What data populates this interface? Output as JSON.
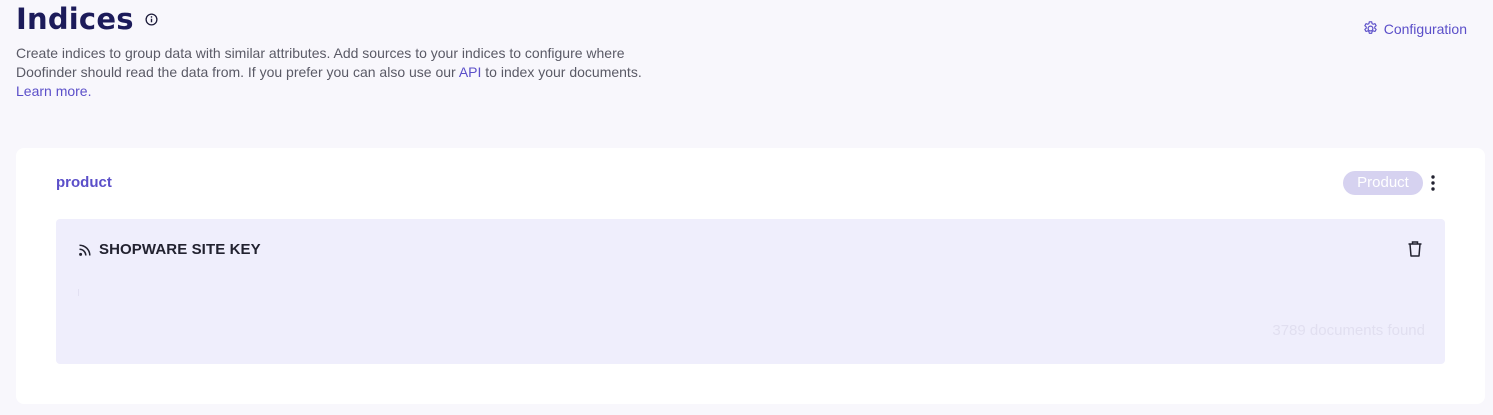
{
  "header": {
    "title": "Indices",
    "description_line1": "Create indices to group data with similar attributes. Add sources to your indices to configure where",
    "description_line2_pre": "Doofinder should read the data from. If you prefer you can also use our ",
    "api_link": "API",
    "description_line2_post": " to index your documents.",
    "learn_more": "Learn more.",
    "config_label": "Configuration"
  },
  "index": {
    "name": "product",
    "badge": "Product",
    "source": {
      "title": "SHOPWARE SITE KEY",
      "documents_found": "3789 documents found"
    }
  },
  "colors": {
    "page_bg": "#f8f7fc",
    "title": "#1c1b5a",
    "accent": "#5b4fc9",
    "badge_bg": "#d6d2f0",
    "source_bg": "#efeefc"
  },
  "icons": {
    "title_info": "info-icon",
    "config": "gear-icon",
    "menu": "kebab-menu-icon",
    "source": "rss-feed-icon",
    "delete": "trash-icon"
  }
}
